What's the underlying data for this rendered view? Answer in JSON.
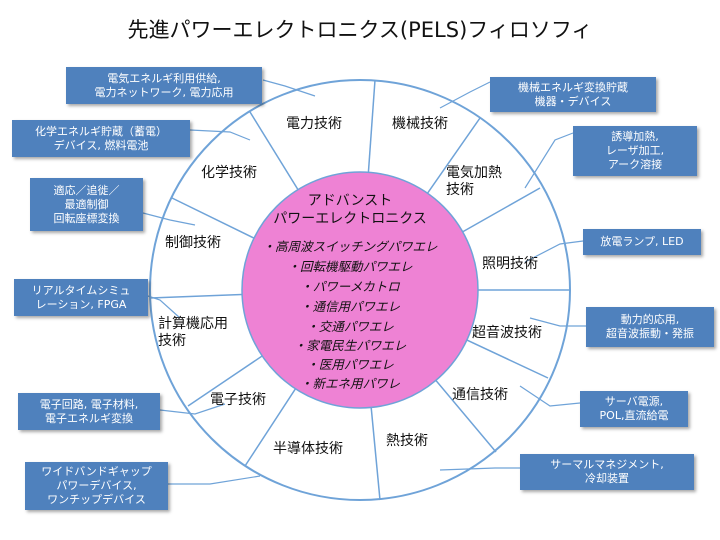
{
  "title": "先進パワーエレクトロニクス(PELS)フィロソフィ",
  "colors": {
    "circle_fill": "#ee82d4",
    "box_fill": "#4f81bd",
    "line": "#6fa3d8"
  },
  "center": {
    "title": "アドバンスト\nパワーエレクトロニクス",
    "items": [
      "・高周波スイッチングパワエレ",
      "・回転機駆動パワエレ",
      "・パワーメカトロ",
      "・通信用パワエレ",
      "・交通パワエレ",
      "・家電民生パワエレ",
      "・医用パワエレ",
      "・新エネ用パワレ"
    ]
  },
  "segments": [
    "電力技術",
    "機械技術",
    "電気加熱\n技術",
    "照明技術",
    "超音波技術",
    "通信技術",
    "熱技術",
    "半導体技術",
    "電子技術",
    "計算機応用\n技術",
    "制御技術",
    "化学技術"
  ],
  "boxes": [
    "電気エネルギ利用供給,\n電力ネットワーク, 電力応用",
    "機械エネルギ変換貯蔵\n機器・デバイス",
    "誘導加熱,\nレーザ加工,\nアーク溶接",
    "放電ランプ, LED",
    "動力的応用,\n超音波振動・発振",
    "サーバ電源,\nPOL,直流給電",
    "サーマルマネジメント,\n冷却装置",
    "ワイドバンドギャップ\nパワーデバイス,\nワンチップデバイス",
    "電子回路, 電子材料,\n電子エネルギ変換",
    "リアルタイムシミュ\nレーション, FPGA",
    "適応／追徙／\n最適制御\n回転座標変換",
    "化学エネルギ貯蔵（蓄電）\nデバイス, 燃料電池"
  ]
}
